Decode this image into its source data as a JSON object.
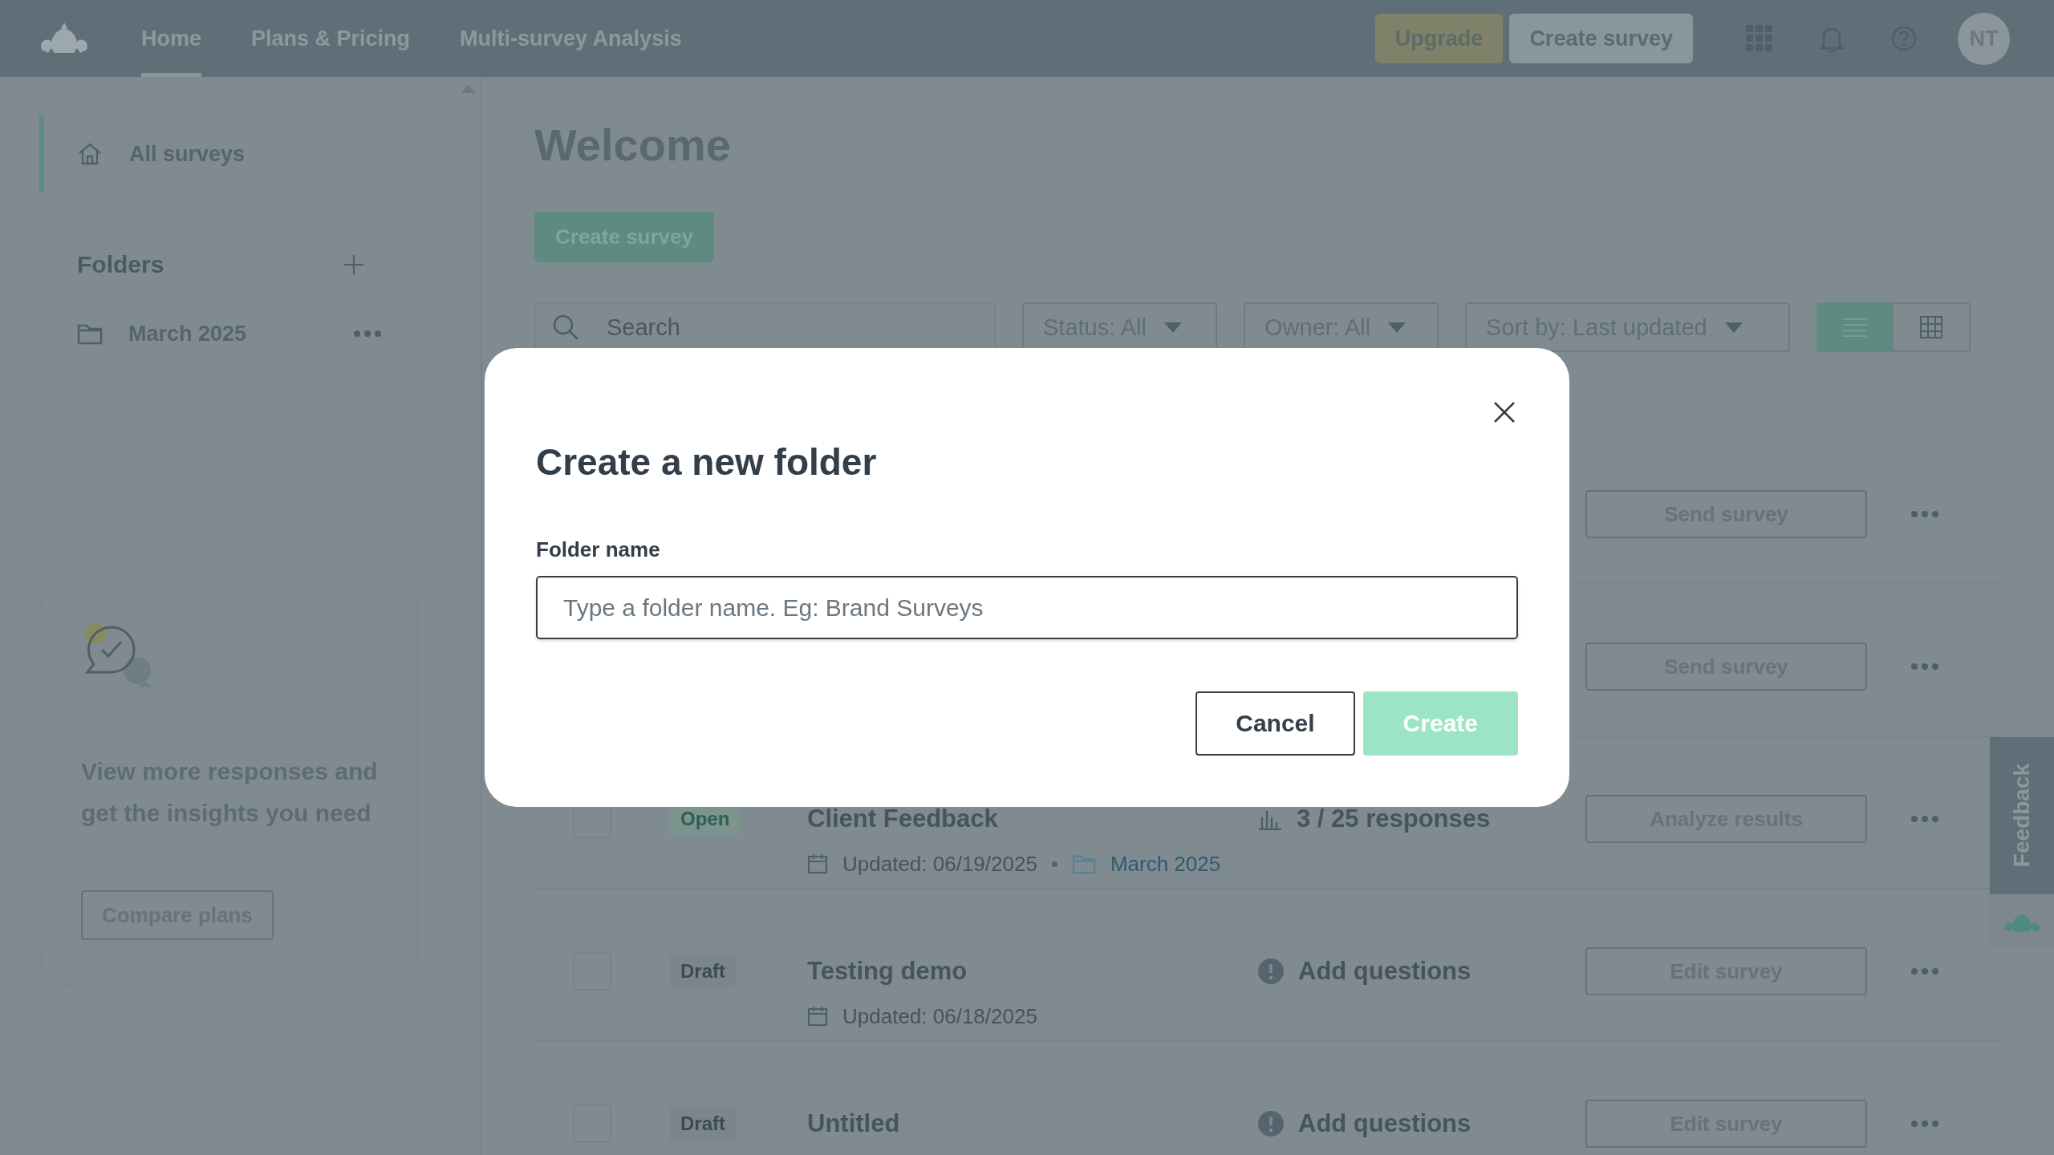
{
  "top_bar": {
    "nav": [
      {
        "label": "Home",
        "selected": true
      },
      {
        "label": "Plans & Pricing",
        "selected": false
      },
      {
        "label": "Multi-survey Analysis",
        "selected": false
      }
    ],
    "buttons": [
      {
        "label": "Upgrade",
        "kind": "upgrade"
      },
      {
        "label": "Create survey",
        "kind": "secondary"
      }
    ],
    "avatar": "NT"
  },
  "sidebar": {
    "items": [
      {
        "label": "All surveys",
        "selected": true
      }
    ],
    "folders_heading": "Folders",
    "folders": [
      {
        "label": "March 2025",
        "selected": false
      }
    ],
    "promo": {
      "text": "View more responses and get the insights you need",
      "button": "Compare plans"
    }
  },
  "main": {
    "title": "Welcome",
    "create_button": "Create survey",
    "search": {
      "placeholder": "Search"
    },
    "filters": [
      {
        "label": "Status: All"
      },
      {
        "label": "Owner: All"
      },
      {
        "label": "Sort by: Last updated"
      }
    ],
    "view_toggle": [
      {
        "kind": "list",
        "selected": true
      },
      {
        "kind": "grid",
        "selected": false
      }
    ],
    "rows": [
      {
        "action": "Send survey"
      },
      {
        "action": "Send survey"
      },
      {
        "checked": false,
        "status": {
          "label": "Open",
          "kind": "open"
        },
        "title": "Client Feedback",
        "info": {
          "kind": "responses",
          "text": "3 / 25 responses"
        },
        "updated": "Updated: 06/19/2025",
        "folder": "March 2025",
        "action": "Analyze results"
      },
      {
        "checked": false,
        "status": {
          "label": "Draft",
          "kind": "draft"
        },
        "title": "Testing demo",
        "info": {
          "kind": "todo",
          "text": "Add questions"
        },
        "updated": "Updated: 06/18/2025",
        "action": "Edit survey"
      },
      {
        "checked": false,
        "status": {
          "label": "Draft",
          "kind": "draft"
        },
        "title": "Untitled",
        "info": {
          "kind": "todo",
          "text": "Add questions"
        },
        "action": "Edit survey"
      }
    ]
  },
  "feedback_tab": "Feedback",
  "dialog": {
    "title": "Create a new folder",
    "field_label": "Folder name",
    "placeholder": "Type a folder name. Eg: Brand Surveys",
    "buttons": [
      {
        "label": "Cancel",
        "kind": "secondary",
        "disabled": false
      },
      {
        "label": "Create",
        "kind": "primary",
        "disabled": true
      }
    ]
  }
}
